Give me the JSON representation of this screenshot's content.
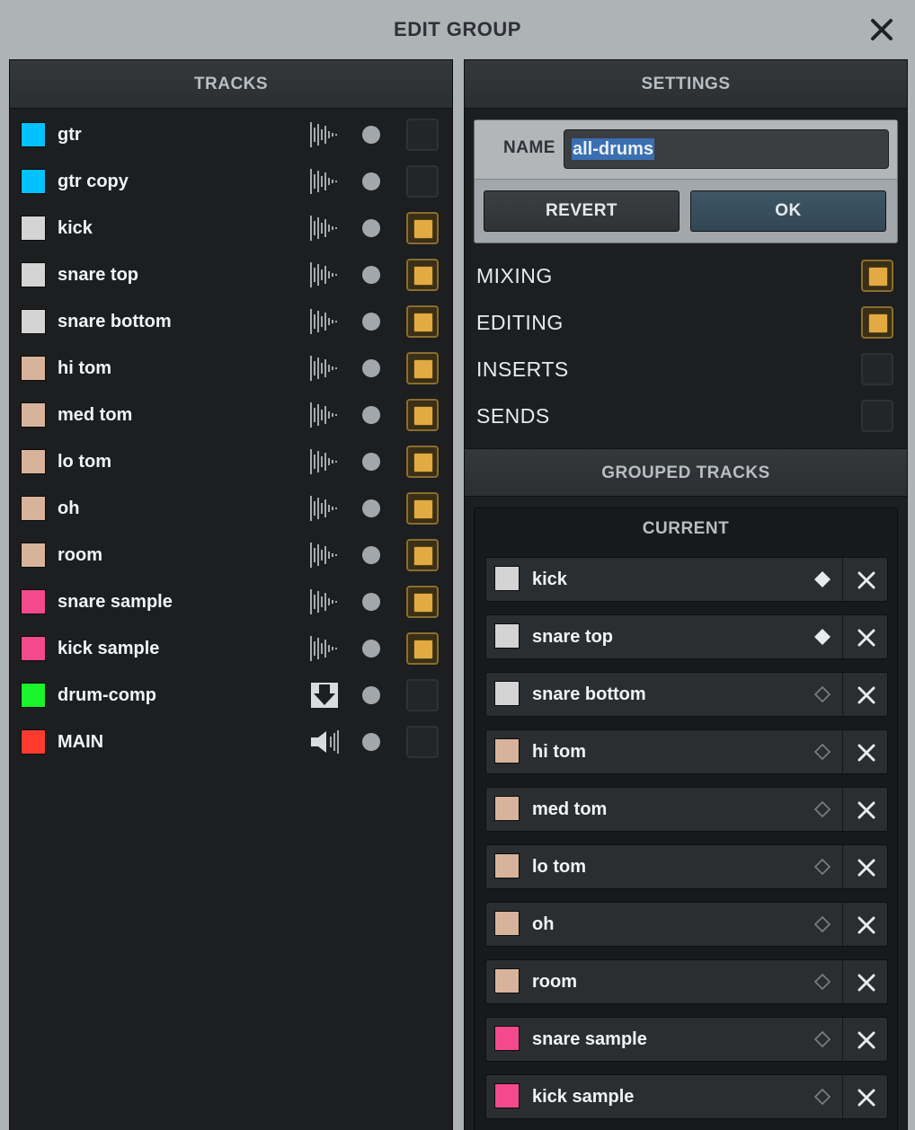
{
  "window": {
    "title": "EDIT GROUP"
  },
  "tracks_panel": {
    "title": "TRACKS",
    "items": [
      {
        "name": "gtr",
        "color": "#00c2ff",
        "type": "waveform",
        "in_group": false
      },
      {
        "name": "gtr copy",
        "color": "#00c2ff",
        "type": "waveform",
        "in_group": false
      },
      {
        "name": "kick",
        "color": "#d4d4d4",
        "type": "waveform",
        "in_group": true
      },
      {
        "name": "snare top",
        "color": "#d4d4d4",
        "type": "waveform",
        "in_group": true
      },
      {
        "name": "snare bottom",
        "color": "#d4d4d4",
        "type": "waveform",
        "in_group": true
      },
      {
        "name": "hi tom",
        "color": "#d8b39b",
        "type": "waveform",
        "in_group": true
      },
      {
        "name": "med tom",
        "color": "#d8b39b",
        "type": "waveform",
        "in_group": true
      },
      {
        "name": "lo tom",
        "color": "#d8b39b",
        "type": "waveform",
        "in_group": true
      },
      {
        "name": "oh",
        "color": "#d8b39b",
        "type": "waveform",
        "in_group": true
      },
      {
        "name": "room",
        "color": "#d8b39b",
        "type": "waveform",
        "in_group": true
      },
      {
        "name": "snare sample",
        "color": "#f4498c",
        "type": "waveform",
        "in_group": true
      },
      {
        "name": "kick sample",
        "color": "#f4498c",
        "type": "waveform",
        "in_group": true
      },
      {
        "name": "drum-comp",
        "color": "#18f52a",
        "type": "bus",
        "in_group": false
      },
      {
        "name": "MAIN",
        "color": "#ff3b30",
        "type": "master",
        "in_group": false
      }
    ]
  },
  "settings_panel": {
    "title": "SETTINGS",
    "name_label": "NAME",
    "name_value": "all-drums",
    "revert_label": "REVERT",
    "ok_label": "OK",
    "options": [
      {
        "label": "MIXING",
        "checked": true
      },
      {
        "label": "EDITING",
        "checked": true
      },
      {
        "label": "INSERTS",
        "checked": false
      },
      {
        "label": "SENDS",
        "checked": false
      }
    ]
  },
  "grouped_tracks": {
    "title": "GROUPED TRACKS",
    "current_label": "CURRENT",
    "items": [
      {
        "name": "kick",
        "color": "#d4d4d4",
        "leader": true
      },
      {
        "name": "snare top",
        "color": "#d4d4d4",
        "leader": true
      },
      {
        "name": "snare bottom",
        "color": "#d4d4d4",
        "leader": false
      },
      {
        "name": "hi tom",
        "color": "#d8b39b",
        "leader": false
      },
      {
        "name": "med tom",
        "color": "#d8b39b",
        "leader": false
      },
      {
        "name": "lo tom",
        "color": "#d8b39b",
        "leader": false
      },
      {
        "name": "oh",
        "color": "#d8b39b",
        "leader": false
      },
      {
        "name": "room",
        "color": "#d8b39b",
        "leader": false
      },
      {
        "name": "snare sample",
        "color": "#f4498c",
        "leader": false
      },
      {
        "name": "kick sample",
        "color": "#f4498c",
        "leader": false
      }
    ]
  }
}
